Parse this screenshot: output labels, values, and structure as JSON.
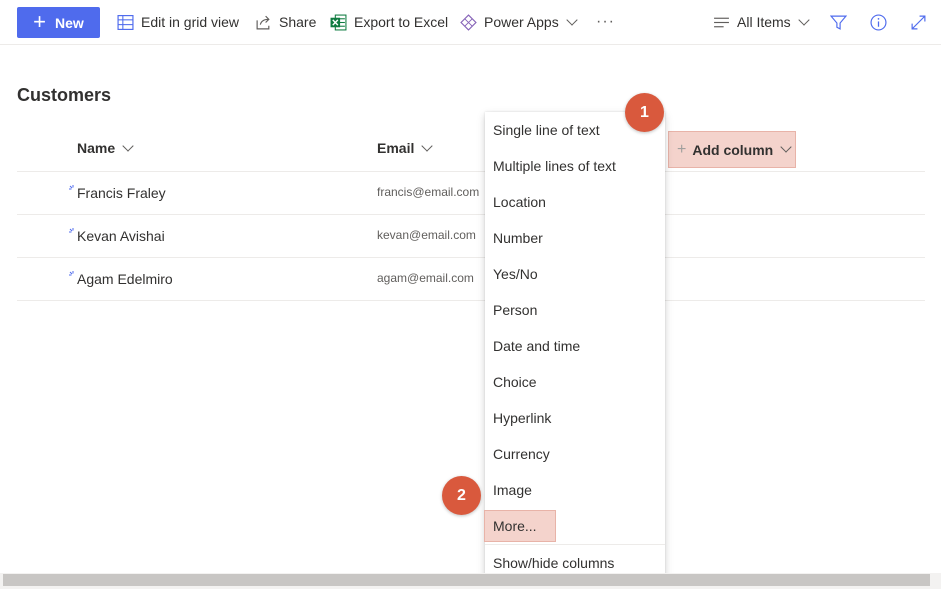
{
  "toolbar": {
    "new_label": "New",
    "edit_grid_label": "Edit in grid view",
    "share_label": "Share",
    "export_label": "Export to Excel",
    "power_apps_label": "Power Apps",
    "more_symbol": "···",
    "view_label": "All Items"
  },
  "list": {
    "title": "Customers",
    "columns": [
      "Name",
      "Email"
    ],
    "rows": [
      {
        "name": "Francis Fraley",
        "email": "francis@email.com"
      },
      {
        "name": "Kevan Avishai",
        "email": "kevan@email.com"
      },
      {
        "name": "Agam Edelmiro",
        "email": "agam@email.com"
      }
    ],
    "add_column_label": "Add column"
  },
  "menu": {
    "items": [
      "Single line of text",
      "Multiple lines of text",
      "Location",
      "Number",
      "Yes/No",
      "Person",
      "Date and time",
      "Choice",
      "Hyperlink",
      "Currency",
      "Image",
      "More..."
    ],
    "footer_item": "Show/hide columns"
  },
  "badges": [
    "1",
    "2"
  ],
  "colors": {
    "accent": "#4f6bed",
    "badge": "#d9593d",
    "highlight": "#f4d3cc",
    "excel_green": "#107c41"
  },
  "icons": {
    "grid": "grid-icon",
    "share": "share-icon",
    "excel": "excel-icon",
    "power_apps": "power-apps-icon",
    "view": "view-lines-icon",
    "filter": "filter-icon",
    "info": "info-icon",
    "expand": "expand-icon"
  }
}
